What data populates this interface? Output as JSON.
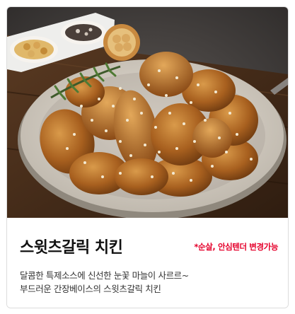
{
  "product": {
    "name": "스윗츠갈릭 치킨",
    "note": "*순살, 안심텐더 변경가능",
    "description": [
      "달콤한 특제소스에 신선한 눈꽃 마늘이 사르르~",
      "부드러운 간장베이스의 스윗츠갈릭 치킨"
    ],
    "image_alt": "스윗츠갈릭 치킨"
  },
  "colors": {
    "note": "#e5002b",
    "title": "#111111",
    "description": "#333333",
    "card_border": "#dcdcdc"
  }
}
